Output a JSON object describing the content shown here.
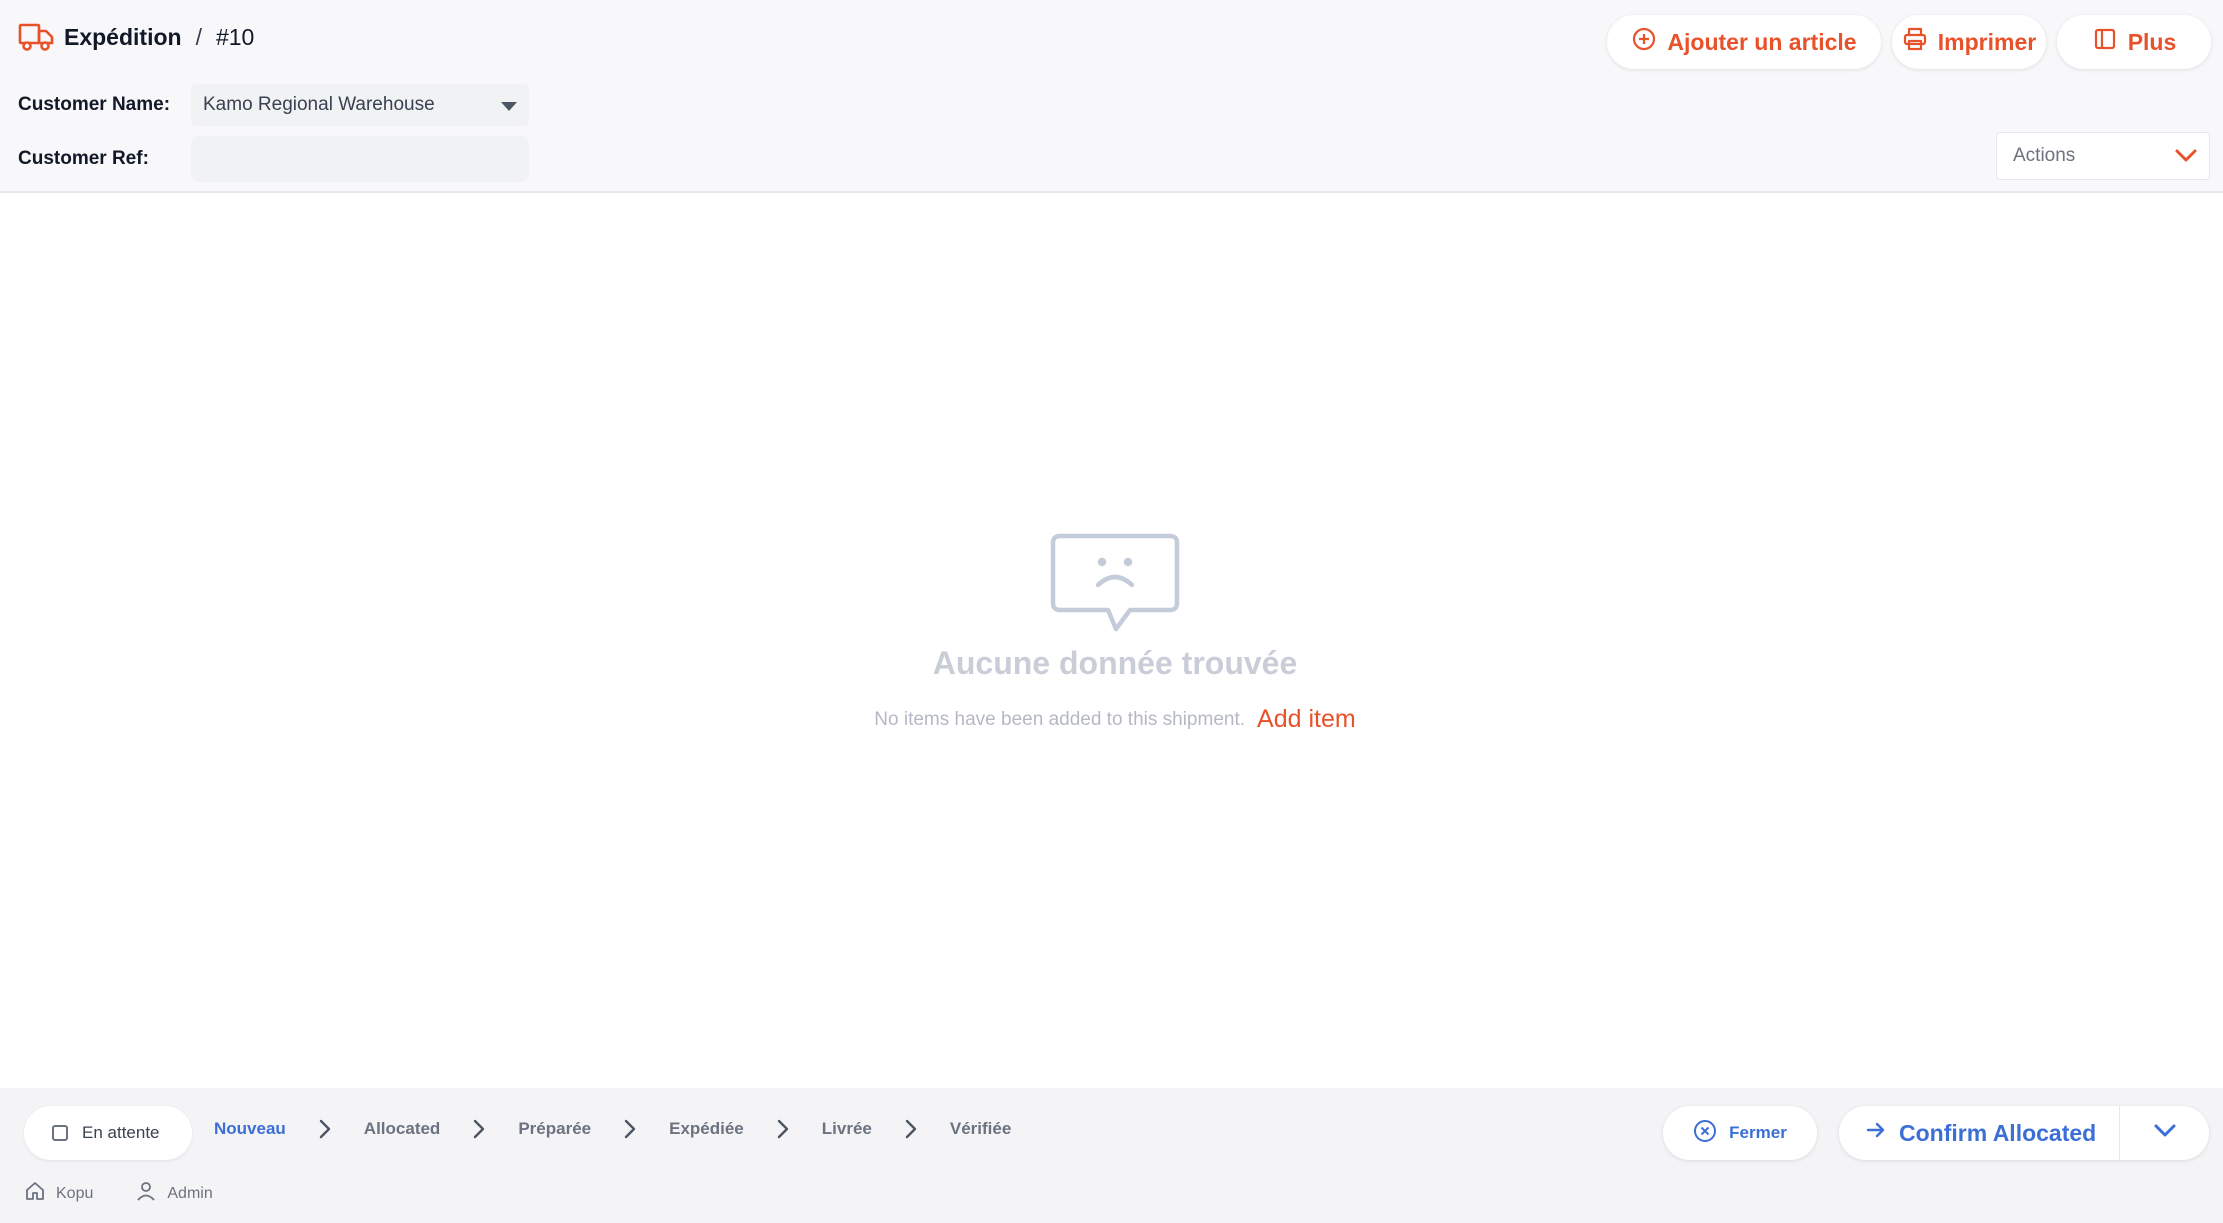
{
  "header": {
    "title": "Expédition",
    "separator": "/",
    "number": "#10",
    "customer_name_label": "Customer Name:",
    "customer_name_value": "Kamo Regional Warehouse",
    "customer_ref_label": "Customer Ref:",
    "customer_ref_value": "",
    "buttons": {
      "add_item": "Ajouter un article",
      "print": "Imprimer",
      "more": "Plus"
    },
    "actions_label": "Actions"
  },
  "empty_state": {
    "title": "Aucune donnée trouvée",
    "description": "No items have been added to this shipment.",
    "add_link": "Add item"
  },
  "footer": {
    "pending_label": "En attente",
    "steps": [
      "Nouveau",
      "Allocated",
      "Préparée",
      "Expédiée",
      "Livrée",
      "Vérifiée"
    ],
    "active_step": "Nouveau",
    "close_label": "Fermer",
    "confirm_label": "Confirm Allocated",
    "location": "Kopu",
    "user": "Admin"
  },
  "colors": {
    "accent_orange": "#e8522a",
    "accent_blue": "#3b6fd6",
    "empty_gray": "#c9cdd8"
  },
  "icons": [
    "truck-icon",
    "plus-circle-icon",
    "printer-icon",
    "panel-icon",
    "chevron-down-icon",
    "sad-chat-icon",
    "chevron-right-icon",
    "x-circle-icon",
    "arrow-right-icon",
    "home-icon",
    "user-icon"
  ]
}
